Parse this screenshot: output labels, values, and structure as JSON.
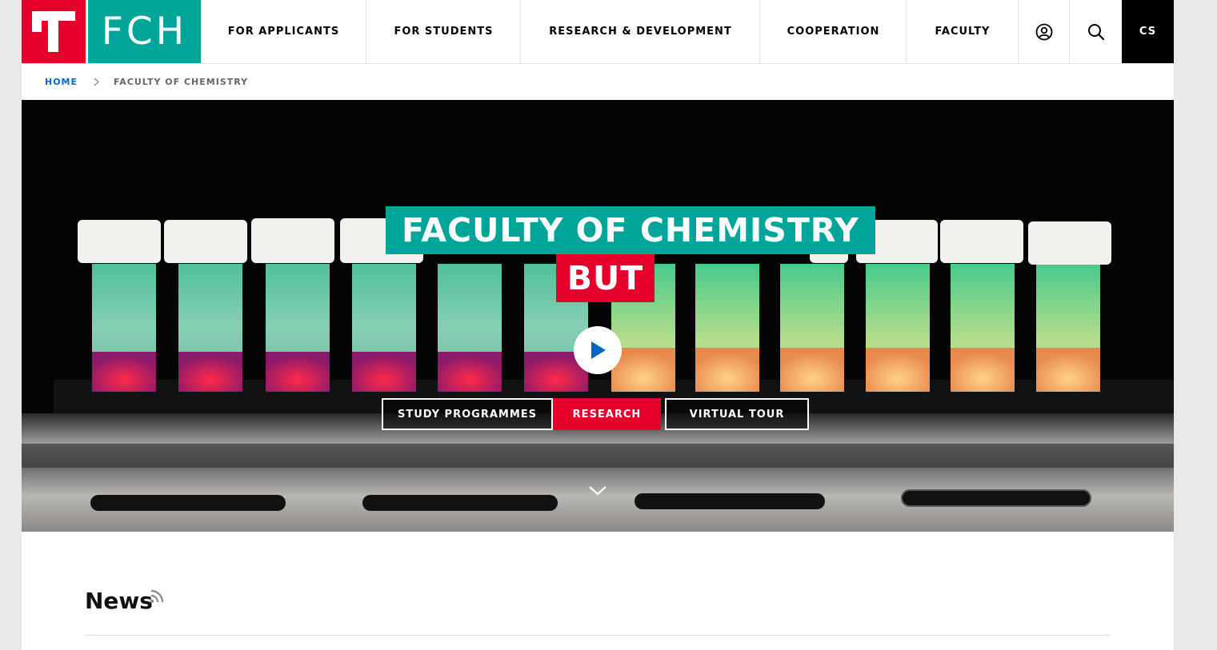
{
  "header": {
    "logo_text": "FCH",
    "nav": [
      {
        "label": "FOR APPLICANTS"
      },
      {
        "label": "FOR STUDENTS"
      },
      {
        "label": "RESEARCH & DEVELOPMENT"
      },
      {
        "label": "COOPERATION"
      },
      {
        "label": "FACULTY"
      }
    ],
    "language": "CS",
    "icons": [
      "user-icon",
      "search-icon"
    ]
  },
  "breadcrumb": {
    "home": "HOME",
    "current": "FACULTY OF CHEMISTRY"
  },
  "hero": {
    "title": "FACULTY OF CHEMISTRY",
    "subtitle": "BUT",
    "buttons": [
      {
        "label": "STUDY PROGRAMMES"
      },
      {
        "label": "RESEARCH"
      },
      {
        "label": "VIRTUAL TOUR"
      }
    ]
  },
  "news": {
    "title": "News"
  },
  "colors": {
    "brand_red": "#e4002b",
    "brand_teal": "#00a499",
    "link_blue": "#0066c0"
  }
}
